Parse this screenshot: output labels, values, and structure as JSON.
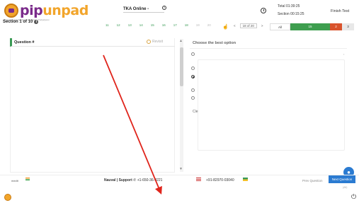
{
  "brand": {
    "logo_text_1": "pip",
    "logo_text_2": "unpad",
    "tagline": "Pusat Inovasi Pelatihan Universitas Padjadjaran"
  },
  "header": {
    "section_label": "Section 1 of 10",
    "test_name": "TKA Online -",
    "timer_total": "Total 01:39:25",
    "timer_section": "Section 00:15:25",
    "finish_button": "Finish Test"
  },
  "question_numbers": [
    "11",
    "12",
    "13",
    "14",
    "15",
    "16",
    "17",
    "18",
    "19",
    "20"
  ],
  "pager": {
    "prev": "<",
    "pill": "18 of 20",
    "next": ">"
  },
  "filters": {
    "all": "All",
    "answered": "15",
    "not_answered": "2",
    "not_visited": "3"
  },
  "question_panel": {
    "title": "Question #",
    "revisit": "Revisit"
  },
  "options_panel": {
    "title": "Choose the best option",
    "partial_label": "Cle",
    "selected_index": 2,
    "side_mark": "r"
  },
  "footer": {
    "logo_text": "medit",
    "support_label": "Nauval | Support",
    "support_phone": "+1-650-36-0221",
    "alt_phone": "+91-82970-03040",
    "prev_question": "Prev Question",
    "next_question": "Next Question",
    "hint": "(Alt)"
  },
  "colors": {
    "brand_purple": "#7a2a8a",
    "brand_orange": "#f2a52b",
    "answered_green": "#3e9e4f",
    "not_answered_red": "#d9532c",
    "primary_blue": "#2b7bd1",
    "annotation_red": "#e0241b"
  },
  "icons": {
    "info": "info-icon",
    "timer": "clock-icon",
    "pointer": "hand-pointer-icon",
    "chat": "chat-bubble-icon",
    "power": "power-icon",
    "phone": "phone-icon"
  }
}
